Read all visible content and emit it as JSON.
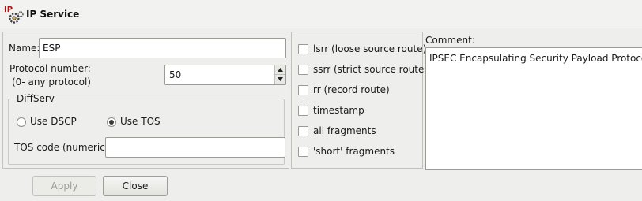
{
  "window": {
    "title": "IP Service",
    "icon": "ip-service-icon"
  },
  "name_field": {
    "label": "Name:",
    "value": "ESP"
  },
  "protocol": {
    "label_line1": "Protocol number:",
    "label_line2": "(0- any protocol)",
    "value": "50"
  },
  "diffserv": {
    "title": "DiffServ",
    "use_dscp_label": "Use DSCP",
    "use_tos_label": "Use TOS",
    "selected": "Use TOS",
    "tos_code_label": "TOS code (numeric):",
    "tos_code_value": ""
  },
  "options": {
    "items": [
      {
        "label": "lsrr (loose source route)",
        "checked": false
      },
      {
        "label": "ssrr (strict source route)",
        "checked": false
      },
      {
        "label": "rr (record route)",
        "checked": false
      },
      {
        "label": "timestamp",
        "checked": false
      },
      {
        "label": "all fragments",
        "checked": false
      },
      {
        "label": "'short' fragments",
        "checked": false
      }
    ]
  },
  "comment": {
    "label": "Comment:",
    "value": "IPSEC Encapsulating Security Payload Protocol"
  },
  "buttons": {
    "apply": "Apply",
    "close": "Close"
  }
}
